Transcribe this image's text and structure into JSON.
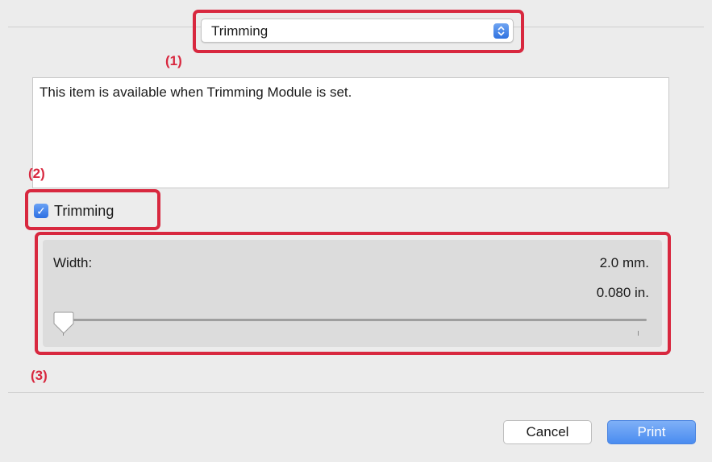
{
  "header": {
    "popup_value": "Trimming"
  },
  "callouts": {
    "c1": "(1)",
    "c2": "(2)",
    "c3": "(3)"
  },
  "description": {
    "text": "This item is available when Trimming Module is set."
  },
  "trimming_checkbox": {
    "label": "Trimming",
    "checked": true
  },
  "width_panel": {
    "label": "Width:",
    "value_mm": "2.0 mm.",
    "value_in": "0.080 in.",
    "slider_position": 0
  },
  "buttons": {
    "cancel": "Cancel",
    "print": "Print"
  },
  "colors": {
    "callout_red": "#d8283f",
    "accent_blue": "#3b7fe6"
  }
}
